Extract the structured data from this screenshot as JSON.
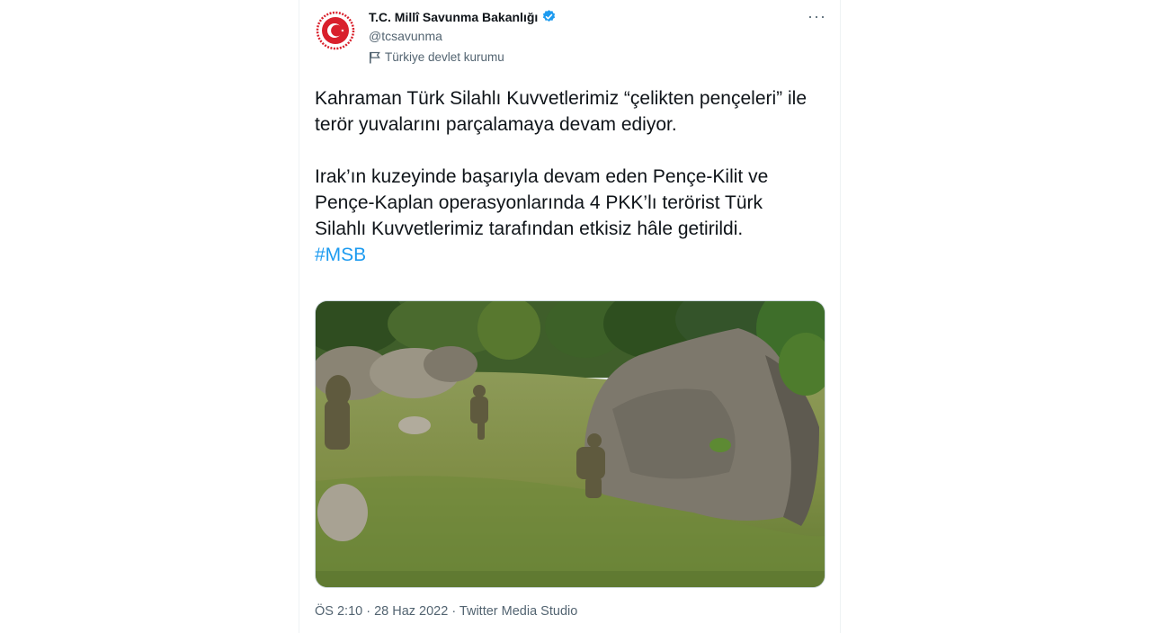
{
  "tweet": {
    "author_name": "T.C. Millî Savunma Bakanlığı",
    "handle": "@tcsavunma",
    "affiliation": "Türkiye devlet kurumu",
    "more_label": "···",
    "paragraph1": "Kahraman Türk Silahlı Kuvvetlerimiz “çelikten pençeleri” ile terör yuvalarını parçalamaya devam ediyor.",
    "paragraph2": "Irak’ın kuzeyinde başarıyla devam eden Pençe-Kilit ve Pençe-Kaplan operasyonlarında 4 PKK’lı terörist Türk Silahlı Kuvvetlerimiz tarafından etkisiz hâle getirildi.",
    "hashtag": "#MSB",
    "meta": "ÖS 2:10 · 28 Haz 2022 · Twitter Media Studio"
  },
  "icons": {
    "verified": "verified-badge-icon",
    "flag": "flag-icon",
    "more": "more-options-icon",
    "avatar": "crescent-star-emblem"
  },
  "colors": {
    "accent": "#1d9bf0",
    "secondary_text": "#536471",
    "emblem_red": "#d9202c"
  }
}
